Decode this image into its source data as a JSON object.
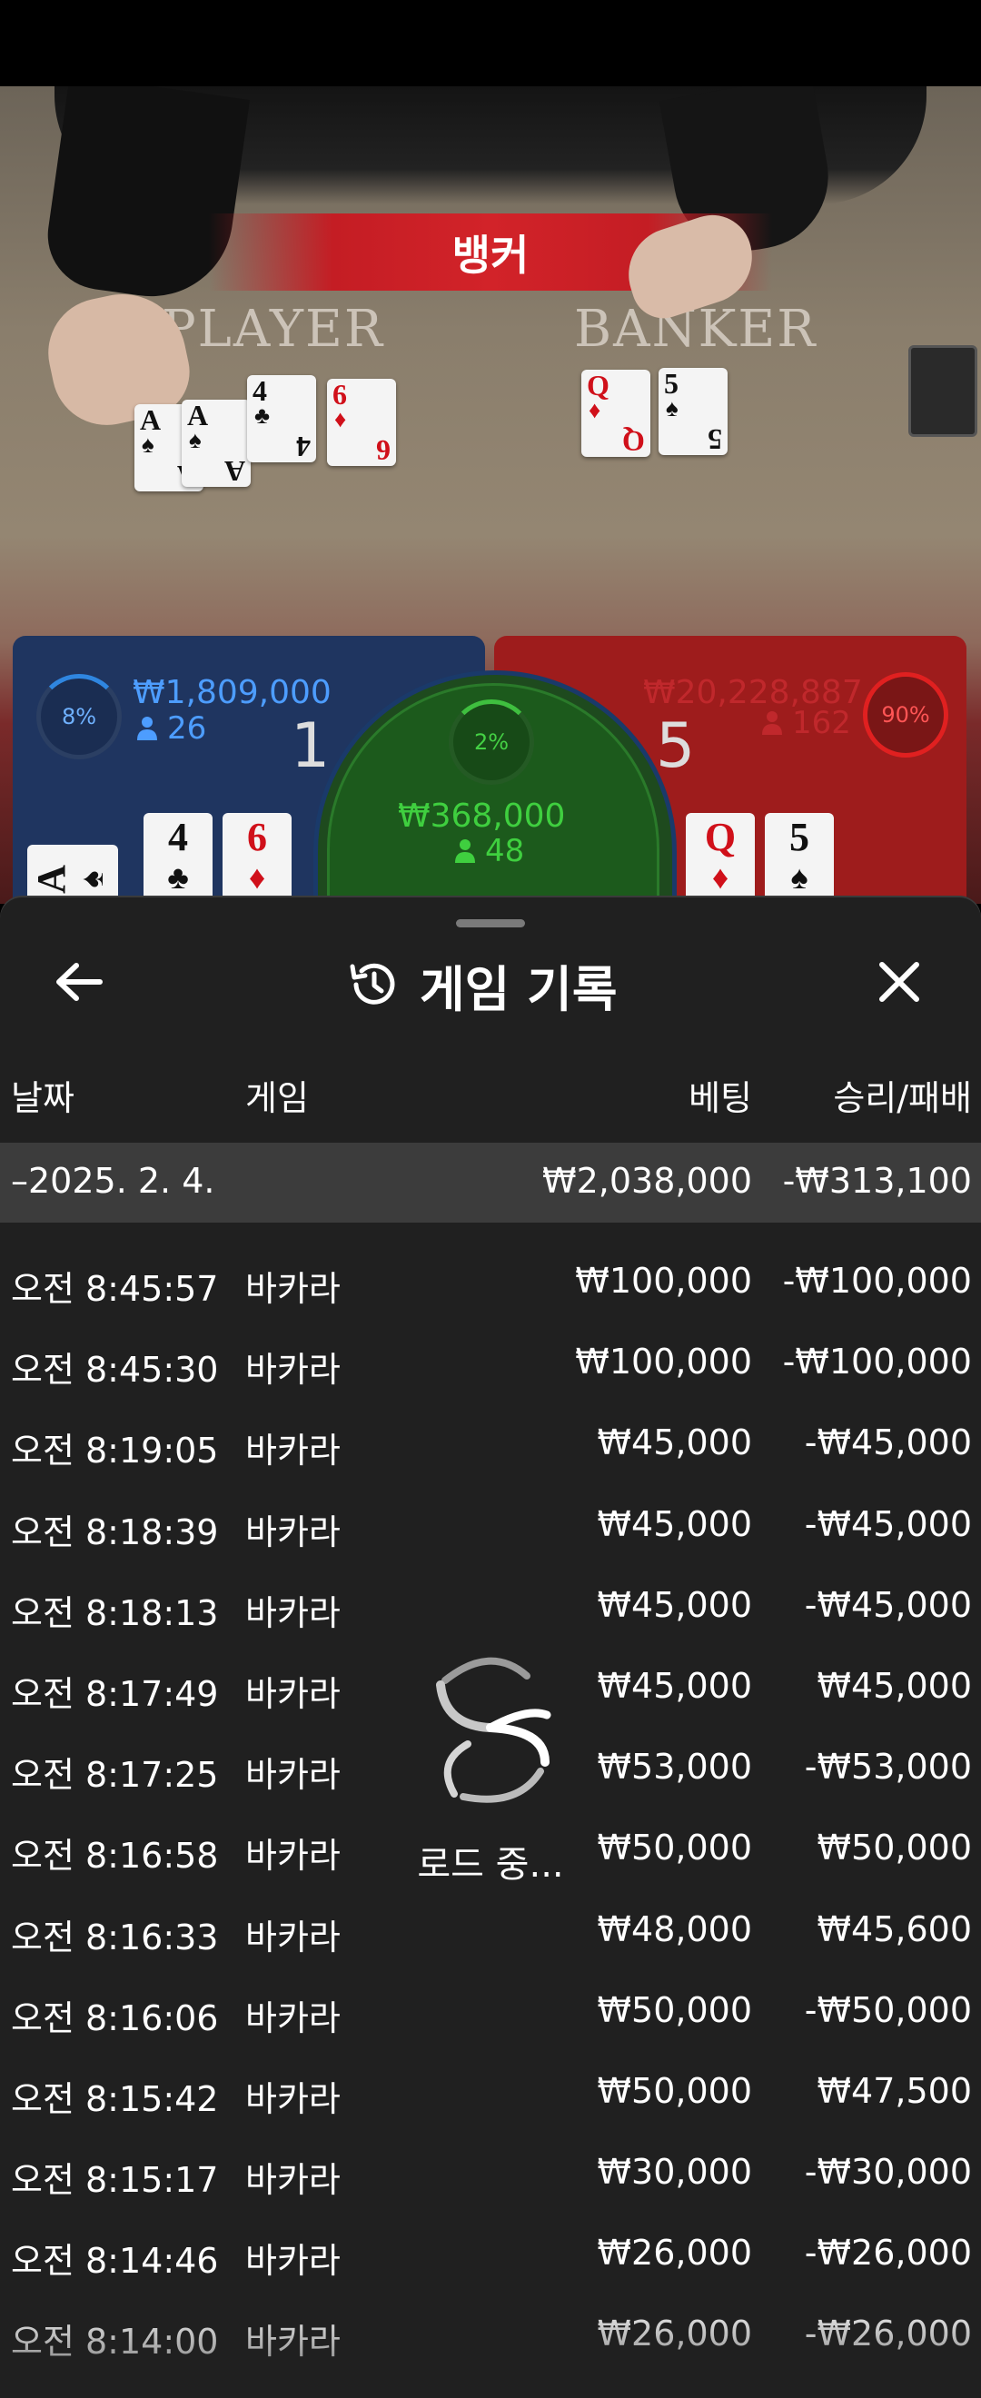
{
  "game_view": {
    "banner": "뱅커",
    "player_label": "PLAYER",
    "banker_label": "BANKER",
    "player_cards": [
      {
        "rank": "A",
        "suit": "♠",
        "color": "black"
      },
      {
        "rank": "A",
        "suit": "♠",
        "color": "black"
      },
      {
        "rank": "4",
        "suit": "♣",
        "color": "black"
      },
      {
        "rank": "6",
        "suit": "♦",
        "color": "red"
      }
    ],
    "banker_cards": [
      {
        "rank": "Q",
        "suit": "♦",
        "color": "red"
      },
      {
        "rank": "5",
        "suit": "♠",
        "color": "black"
      }
    ]
  },
  "bets": {
    "player": {
      "percent": "8%",
      "amount": "₩1,809,000",
      "count": "26",
      "score": "1",
      "color": "#2f86e0",
      "cards": [
        {
          "rank": "A",
          "suit": "♠"
        },
        {
          "rank": "4",
          "suit": "♣"
        },
        {
          "rank": "6",
          "suit": "♦"
        }
      ]
    },
    "tie": {
      "percent": "2%",
      "amount": "₩368,000",
      "count": "48",
      "color": "#3fbf3f"
    },
    "banker": {
      "percent": "90%",
      "amount": "₩20,228,887",
      "count": "162",
      "score": "5",
      "color": "#e02020",
      "cards": [
        {
          "rank": "Q",
          "suit": "♦"
        },
        {
          "rank": "5",
          "suit": "♠"
        }
      ]
    }
  },
  "history": {
    "title": "게임 기록",
    "columns": {
      "date": "날짜",
      "game": "게임",
      "bet": "베팅",
      "result": "승리/패배"
    },
    "group": {
      "date": "–2025. 2. 4.",
      "bet": "₩2,038,000",
      "result": "-₩313,100"
    },
    "rows": [
      {
        "time": "오전 8:45:57",
        "game": "바카라",
        "bet": "₩100,000",
        "result": "-₩100,000"
      },
      {
        "time": "오전 8:45:30",
        "game": "바카라",
        "bet": "₩100,000",
        "result": "-₩100,000"
      },
      {
        "time": "오전 8:19:05",
        "game": "바카라",
        "bet": "₩45,000",
        "result": "-₩45,000"
      },
      {
        "time": "오전 8:18:39",
        "game": "바카라",
        "bet": "₩45,000",
        "result": "-₩45,000"
      },
      {
        "time": "오전 8:18:13",
        "game": "바카라",
        "bet": "₩45,000",
        "result": "-₩45,000"
      },
      {
        "time": "오전 8:17:49",
        "game": "바카라",
        "bet": "₩45,000",
        "result": "₩45,000"
      },
      {
        "time": "오전 8:17:25",
        "game": "바카라",
        "bet": "₩53,000",
        "result": "-₩53,000"
      },
      {
        "time": "오전 8:16:58",
        "game": "바카라",
        "bet": "₩50,000",
        "result": "₩50,000"
      },
      {
        "time": "오전 8:16:33",
        "game": "바카라",
        "bet": "₩48,000",
        "result": "₩45,600"
      },
      {
        "time": "오전 8:16:06",
        "game": "바카라",
        "bet": "₩50,000",
        "result": "-₩50,000"
      },
      {
        "time": "오전 8:15:42",
        "game": "바카라",
        "bet": "₩50,000",
        "result": "₩47,500"
      },
      {
        "time": "오전 8:15:17",
        "game": "바카라",
        "bet": "₩30,000",
        "result": "-₩30,000"
      },
      {
        "time": "오전 8:14:46",
        "game": "바카라",
        "bet": "₩26,000",
        "result": "-₩26,000"
      },
      {
        "time": "오전 8:14:00",
        "game": "바카라",
        "bet": "₩26,000",
        "result": "-₩26,000"
      }
    ],
    "loading": "로드 중..."
  }
}
